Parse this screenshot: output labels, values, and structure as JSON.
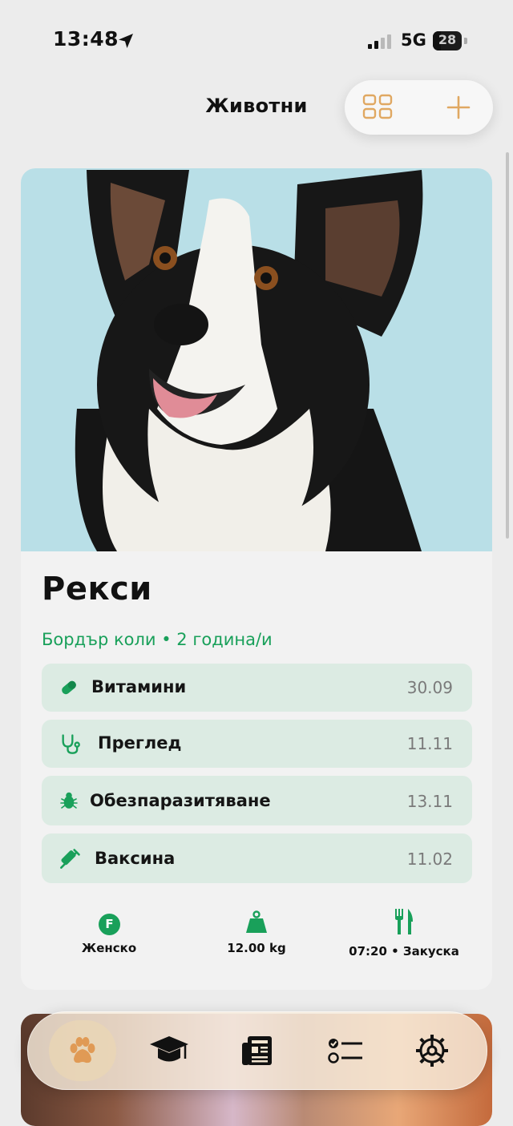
{
  "status_bar": {
    "time": "13:48",
    "network": "5G",
    "battery": "28"
  },
  "header": {
    "title": "Животни"
  },
  "pet": {
    "name": "Рекси",
    "subtitle": "Бордър коли • 2 година/и",
    "events": [
      {
        "icon": "pill-icon",
        "label": "Витамини",
        "date": "30.09"
      },
      {
        "icon": "stethoscope-icon",
        "label": "Преглед",
        "date": "11.11"
      },
      {
        "icon": "bug-icon",
        "label": "Обезпаразитяване",
        "date": "13.11"
      },
      {
        "icon": "syringe-icon",
        "label": "Ваксина",
        "date": "11.02"
      }
    ],
    "info": {
      "gender_badge": "F",
      "gender": "Женско",
      "weight": "12.00 kg",
      "feeding": "07:20 • Закуска"
    }
  },
  "tabbar": {
    "tabs": [
      "paw-icon",
      "graduation-cap-icon",
      "newspaper-icon",
      "checklist-icon",
      "settings-icon"
    ],
    "active_tab": 0
  },
  "colors": {
    "accent_green": "#19a05a",
    "accent_orange": "#e8b070",
    "event_bg": "#dcebe3"
  }
}
